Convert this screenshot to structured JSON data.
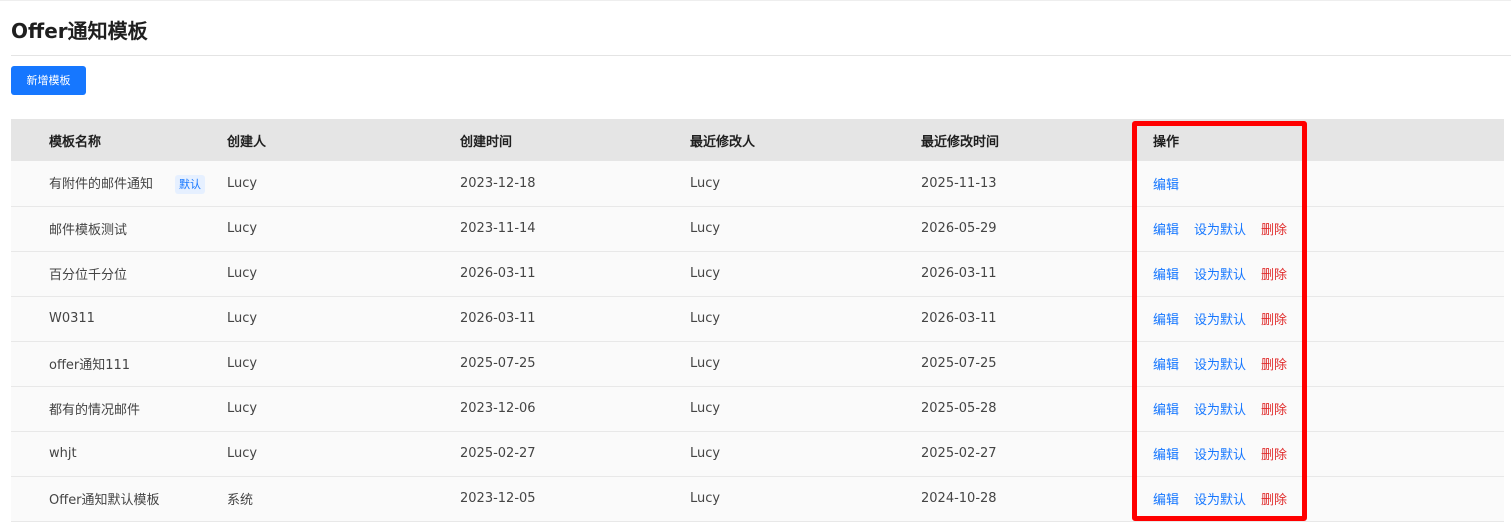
{
  "page": {
    "title": "Offer通知模板"
  },
  "toolbar": {
    "add_label": "新增模板"
  },
  "table": {
    "columns": [
      "模板名称",
      "创建人",
      "创建时间",
      "最近修改人",
      "最近修改时间",
      "操作"
    ],
    "actions": {
      "edit": "编辑",
      "set_default": "设为默认",
      "delete": "删除"
    },
    "default_badge": "默认",
    "rows": [
      {
        "name": "有附件的邮件通知",
        "creator": "Lucy",
        "created": "2023-12-18",
        "modifier": "Lucy",
        "modified": "2025-11-13",
        "is_default": true
      },
      {
        "name": "邮件模板测试",
        "creator": "Lucy",
        "created": "2023-11-14",
        "modifier": "Lucy",
        "modified": "2026-05-29",
        "is_default": false
      },
      {
        "name": "百分位千分位",
        "creator": "Lucy",
        "created": "2026-03-11",
        "modifier": "Lucy",
        "modified": "2026-03-11",
        "is_default": false
      },
      {
        "name": "W0311",
        "creator": "Lucy",
        "created": "2026-03-11",
        "modifier": "Lucy",
        "modified": "2026-03-11",
        "is_default": false
      },
      {
        "name": "offer通知111",
        "creator": "Lucy",
        "created": "2025-07-25",
        "modifier": "Lucy",
        "modified": "2025-07-25",
        "is_default": false
      },
      {
        "name": "都有的情况邮件",
        "creator": "Lucy",
        "created": "2023-12-06",
        "modifier": "Lucy",
        "modified": "2025-05-28",
        "is_default": false
      },
      {
        "name": "whjt",
        "creator": "Lucy",
        "created": "2025-02-27",
        "modifier": "Lucy",
        "modified": "2025-02-27",
        "is_default": false
      },
      {
        "name": "Offer通知默认模板",
        "creator": "系统",
        "created": "2023-12-05",
        "modifier": "Lucy",
        "modified": "2024-10-28",
        "is_default": false
      }
    ]
  },
  "colors": {
    "primary": "#1677ff",
    "danger": "#e02b2b",
    "highlight": "#ff0000",
    "header_bg": "#e5e5e5",
    "row_bg": "#fafafa"
  }
}
